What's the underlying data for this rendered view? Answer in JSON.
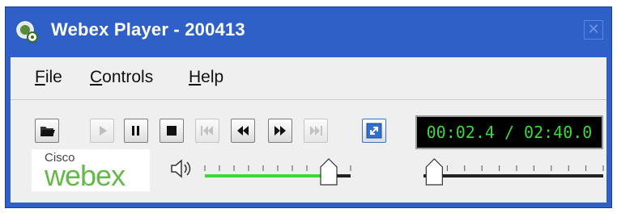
{
  "window": {
    "title": "Webex Player - 200413",
    "close_glyph": "✕",
    "title_color": "#2e60c8"
  },
  "menu": {
    "items": [
      {
        "underline": "F",
        "rest": "ile"
      },
      {
        "underline": "C",
        "rest": "ontrols"
      },
      {
        "underline": "H",
        "rest": "elp"
      }
    ]
  },
  "toolbar": {
    "buttons": [
      {
        "name": "open-file-button",
        "icon": "folder-icon",
        "enabled": true
      },
      {
        "name": "play-button",
        "icon": "play-icon",
        "enabled": false
      },
      {
        "name": "pause-button",
        "icon": "pause-icon",
        "enabled": true
      },
      {
        "name": "stop-button",
        "icon": "stop-icon",
        "enabled": true
      },
      {
        "name": "skip-to-start-button",
        "icon": "skip-to-start-icon",
        "enabled": false
      },
      {
        "name": "rewind-button",
        "icon": "rewind-icon",
        "enabled": true
      },
      {
        "name": "fast-forward-button",
        "icon": "fast-forward-icon",
        "enabled": true
      },
      {
        "name": "skip-to-end-button",
        "icon": "skip-to-end-icon",
        "enabled": false
      },
      {
        "name": "fullscreen-button",
        "icon": "fullscreen-icon",
        "enabled": true
      }
    ]
  },
  "time_display": {
    "text": "00:02.4 / 02:40.0",
    "text_color": "#39d939"
  },
  "logo": {
    "cisco": "Cisco",
    "webex": "webex",
    "webex_color": "#65b84a"
  },
  "volume": {
    "level": 0.85,
    "fill_color": "#39d939"
  },
  "playback_position": {
    "fraction": 0.025
  }
}
